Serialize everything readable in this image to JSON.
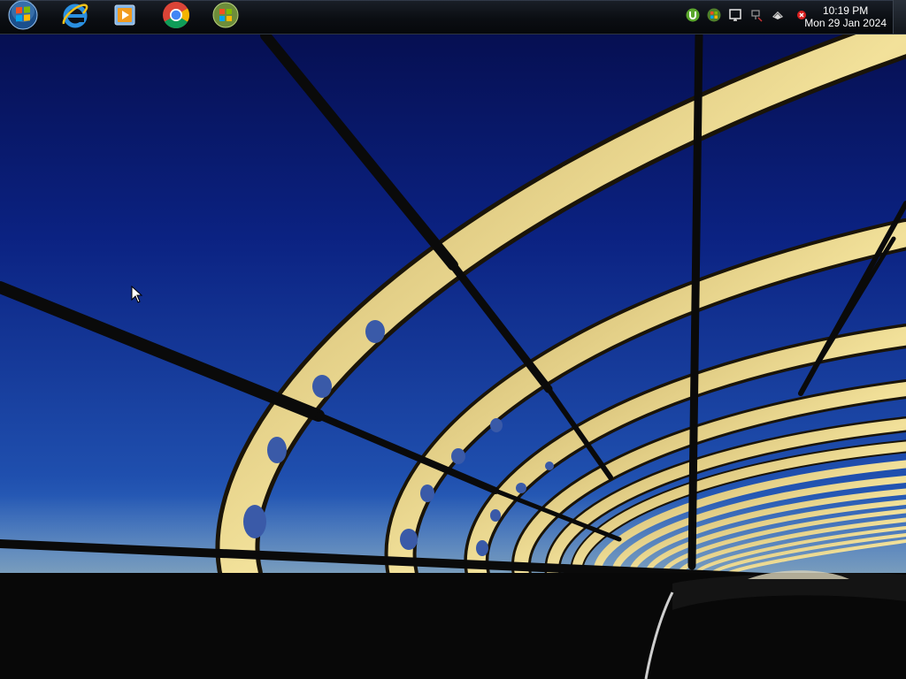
{
  "taskbar": {
    "pinned": [
      {
        "icon": "windows-start-orb-icon"
      },
      {
        "icon": "internet-explorer-icon"
      },
      {
        "icon": "windows-media-player-icon"
      },
      {
        "icon": "google-chrome-icon"
      },
      {
        "icon": "windows-update-icon"
      }
    ],
    "tray": [
      {
        "icon": "utorrent-icon"
      },
      {
        "icon": "windows-colorful-tray-icon"
      },
      {
        "icon": "action-center-flag-icon"
      },
      {
        "icon": "network-icon"
      },
      {
        "icon": "volume-icon"
      },
      {
        "icon": "error-red-x-icon"
      }
    ],
    "clock": {
      "time": "10:19 PM",
      "date": "Mon 29 Jan 2024"
    }
  },
  "colors": {
    "sky_top": "#0a1a6e",
    "sky_bottom": "#2e5fb6",
    "bridge_gold": "#e8d17a",
    "taskbar": "#0b0e13"
  }
}
